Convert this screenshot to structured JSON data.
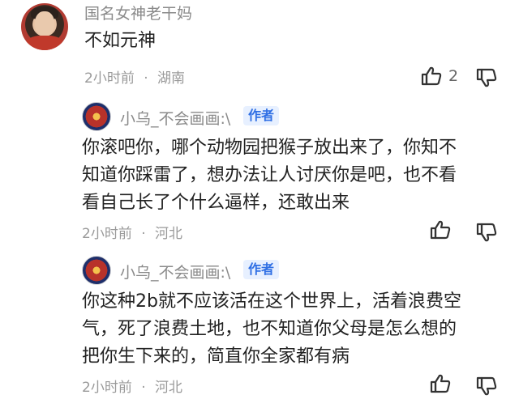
{
  "top_comment": {
    "username": "国名女神老干妈",
    "text": "不如元神",
    "time": "2小时前",
    "location": "湖南",
    "likes": "2"
  },
  "replies": [
    {
      "username": "小乌_不会画画:\\",
      "badge": "作者",
      "lines": [
        "你滚吧你，哪个动物园把猴子放出来了，你知不",
        "知道你踩雷了，想办法让人讨厌你是吧，也不看",
        "看自己长了个什么逼样，还敢出来"
      ],
      "time": "2小时前",
      "location": "河北"
    },
    {
      "username": "小乌_不会画画:\\",
      "badge": "作者",
      "lines": [
        "你这种2b就不应该活在这个世界上，活着浪费空",
        "气，死了浪费土地，也不知道你父母是怎么想的",
        "把你生下来的，简直你全家都有病"
      ],
      "time": "2小时前",
      "location": "河北"
    }
  ],
  "separator": "·",
  "icons": [
    "thumbs-up-icon",
    "thumbs-down-icon"
  ]
}
